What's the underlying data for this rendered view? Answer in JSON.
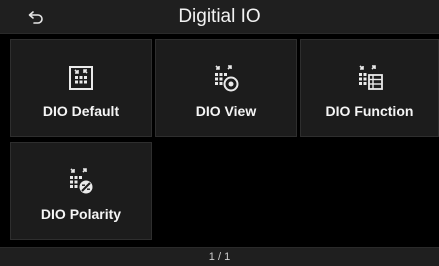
{
  "header": {
    "title": "Digitial IO",
    "back_icon": "return-arrow-icon"
  },
  "tiles": [
    {
      "label": "DIO Default",
      "icon": "dio-default-icon"
    },
    {
      "label": "DIO View",
      "icon": "dio-view-icon"
    },
    {
      "label": "DIO Function",
      "icon": "dio-function-icon"
    },
    {
      "label": "DIO Polarity",
      "icon": "dio-polarity-icon"
    }
  ],
  "footer": {
    "page_indicator": "1 / 1"
  },
  "colors": {
    "background": "#000000",
    "bar": "#1f1f1f",
    "tile": "#1c1c1c",
    "text": "#ffffff"
  }
}
